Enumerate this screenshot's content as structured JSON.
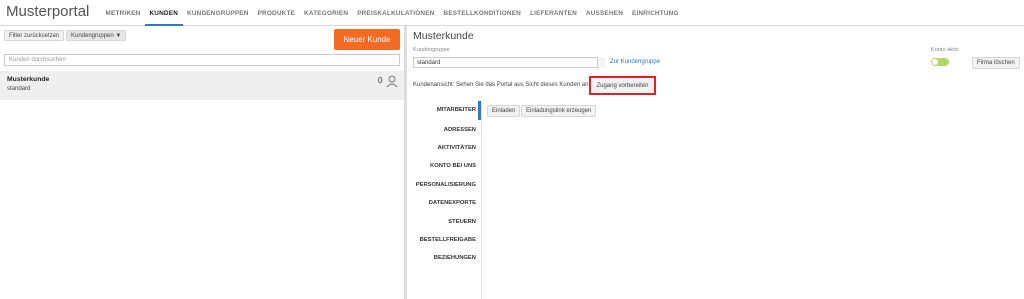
{
  "header": {
    "brand": "Musterportal",
    "nav": [
      "METRIKEN",
      "KUNDEN",
      "KUNDENGRUPPEN",
      "PRODUKTE",
      "KATEGORIEN",
      "PREISKALKULATIONEN",
      "BESTELLKONDITIONEN",
      "LIEFERANTEN",
      "AUSSEHEN",
      "EINRICHTUNG"
    ],
    "active_nav": "KUNDEN"
  },
  "left": {
    "filter_reset": "Filter zurücksetzen",
    "group_filter": "Kundengruppen ▼",
    "new_customer": "Neuer Kunde",
    "search_placeholder": "Kunden durchsuchen",
    "customer": {
      "name": "Musterkunde",
      "group": "standard",
      "count": "0"
    }
  },
  "detail": {
    "title": "Musterkunde",
    "group_label": "Kundengruppe",
    "group_value": "standard",
    "group_link": "Zur Kundengruppe",
    "active_label": "Konto aktiv",
    "active": true,
    "delete_button": "Firma löschen",
    "info": "Kundenansicht: Sehen Sie das Portal aus Sicht dieses Kunden an",
    "access_button": "Zugang vorbereiten",
    "tabs": [
      "MITARBEITER",
      "ADRESSEN",
      "AKTIVITÄTEN",
      "KONTO BEI UNS",
      "PERSONALISIERUNG",
      "DATENEXPORTE",
      "STEUERN",
      "BESTELLFREIGABE",
      "BEZIEHUNGEN"
    ],
    "invite_button": "Einladen",
    "invite_link_button": "Einladungslink erzeugen"
  },
  "colors": {
    "accent": "#2e7bc4",
    "new_button": "#f36b22",
    "highlight_border": "#d9242b",
    "toggle": "#b7d56a"
  }
}
